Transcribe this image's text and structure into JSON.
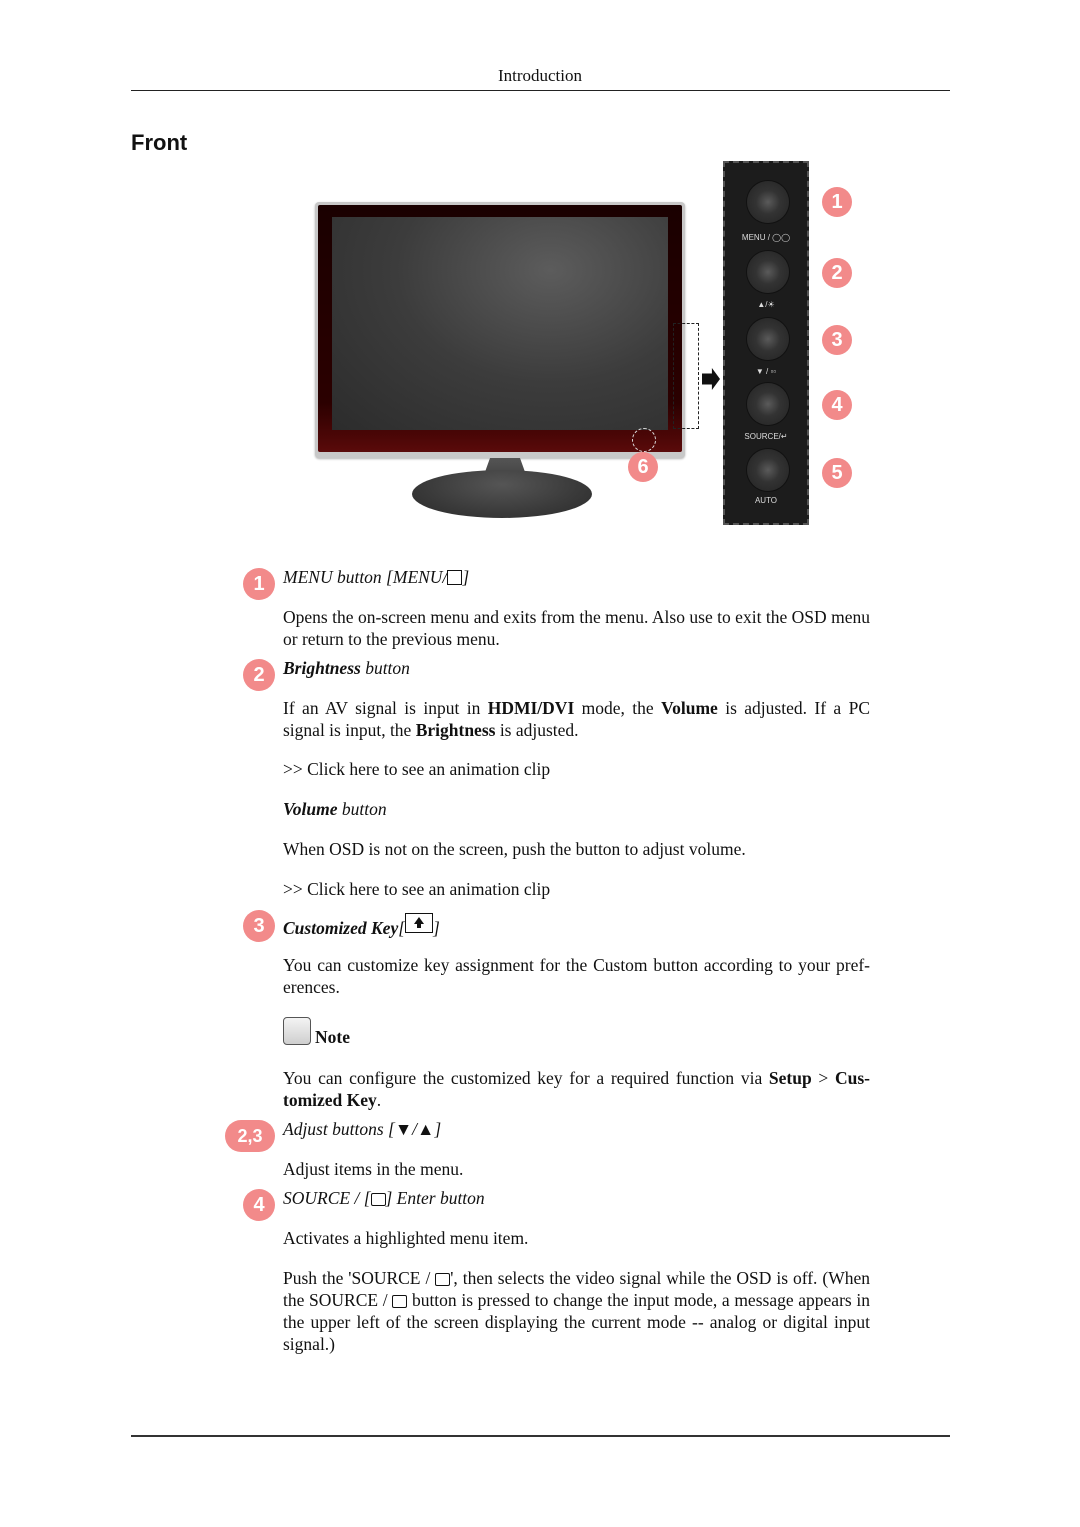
{
  "header": {
    "title": "Introduction"
  },
  "section": {
    "title": "Front"
  },
  "figure": {
    "panel_buttons": [
      {
        "number": "1",
        "label": "MENU / ◯◯"
      },
      {
        "number": "2",
        "label": "▲/☀"
      },
      {
        "number": "3",
        "label": "▼ / ▫▫"
      },
      {
        "number": "4",
        "label": "SOURCE/↵"
      },
      {
        "number": "5",
        "label": "AUTO"
      }
    ],
    "power_badge": "6",
    "icons": {
      "panel_arrow": "right-arrow-icon"
    }
  },
  "entries": {
    "menu": {
      "badge": "1",
      "title": "MENU button [MENU/",
      "title_end": "]",
      "icon": "menu-icon",
      "desc": "Opens the on-screen menu and exits from the menu. Also use to exit the OSD menu or return to the previous menu."
    },
    "brightness": {
      "badge": "2",
      "title_bold": "Brightness",
      "title_rest": " button",
      "desc_parts": [
        "If an AV signal is input in ",
        "HDMI/DVI",
        " mode, the ",
        "Volume",
        " is adjusted. If a PC signal is input, the ",
        "Brightness",
        " is adjusted."
      ],
      "link": ">> Click here to see an animation clip"
    },
    "volume": {
      "title_bold": "Volume",
      "title_rest": " button",
      "desc": "When OSD is not on the screen, push the button to adjust volume.",
      "link": ">> Click here to see an animation clip"
    },
    "customized": {
      "badge": "3",
      "title_bold": "Customized Key",
      "bracket_open": "[",
      "bracket_close": "]",
      "icon": "customized-key-icon",
      "desc": "You can customize key assignment for the Custom button according to your pref- erences.",
      "note_label": "Note",
      "note_parts": [
        "You can configure the customized key for a required function via ",
        "Setup",
        " > ",
        "Cus- tomized Key",
        "."
      ]
    },
    "adjust": {
      "badge": "2,3",
      "title": "Adjust buttons [▼/▲]",
      "desc": "Adjust items in the menu."
    },
    "source": {
      "badge": "4",
      "title_a": "SOURCE / [",
      "title_b": "] Enter button",
      "icon": "enter-icon",
      "desc1": "Activates a highlighted menu item.",
      "desc2_a": "Push the 'SOURCE / ",
      "desc2_b": "', then selects the video signal while the OSD is off. (When the SOURCE / ",
      "desc2_c": " button is pressed to change the input mode, a message appears in the upper left of the screen displaying the current mode -- analog or digital input signal.)"
    }
  },
  "colors": {
    "badge": "#f28a8a",
    "text": "#111111"
  }
}
